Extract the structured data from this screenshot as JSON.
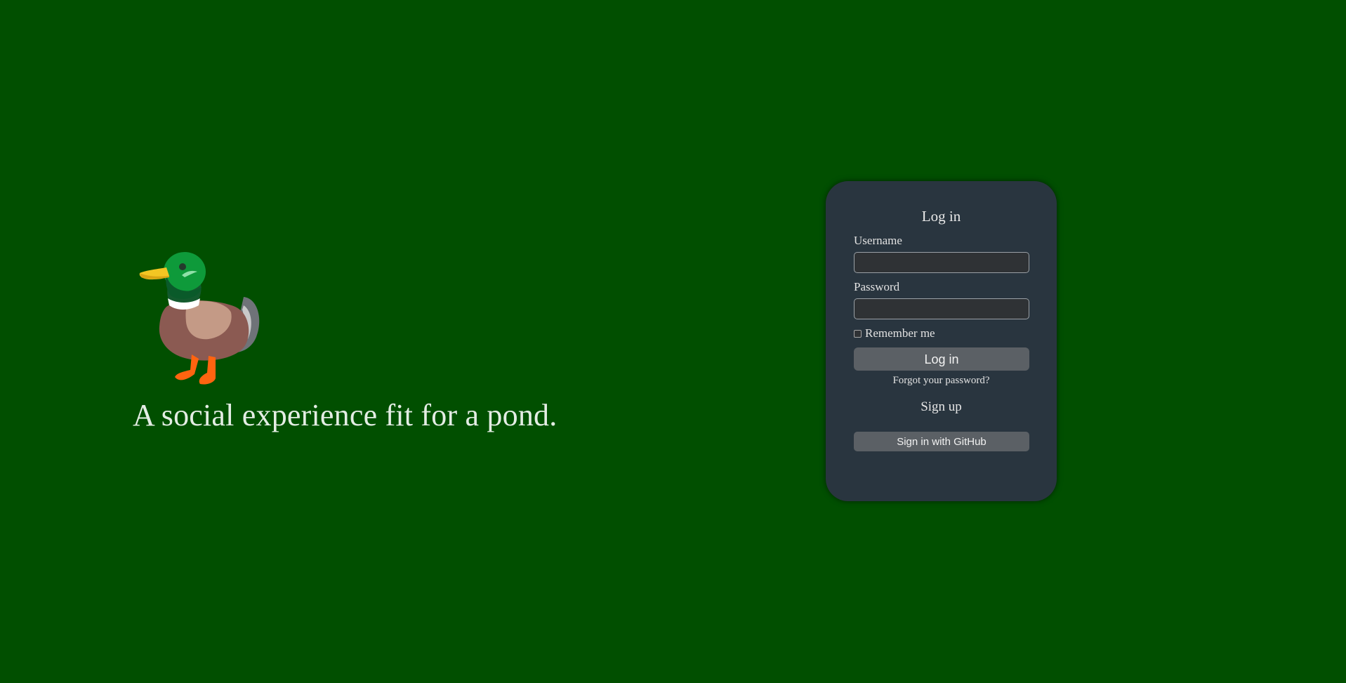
{
  "hero": {
    "logo_icon": "mallard-duck-icon",
    "tagline": "A social experience fit for a pond."
  },
  "login": {
    "title": "Log in",
    "username_label": "Username",
    "username_value": "",
    "password_label": "Password",
    "password_value": "",
    "remember_label": "Remember me",
    "remember_checked": false,
    "submit_label": "Log in",
    "forgot_label": "Forgot your password?",
    "signup_label": "Sign up",
    "github_label": "Sign in with GitHub"
  },
  "colors": {
    "background": "#014f00",
    "card": "#29353f",
    "button": "#5b6065"
  }
}
